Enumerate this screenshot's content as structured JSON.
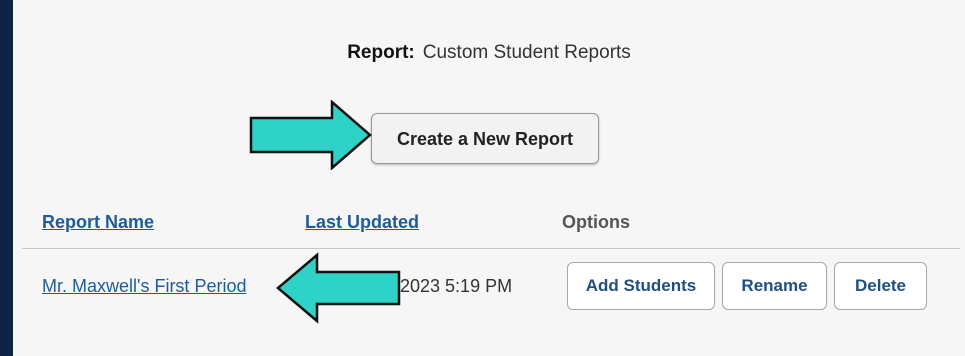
{
  "report": {
    "label": "Report:",
    "name": "Custom Student Reports"
  },
  "create_button": "Create a New Report",
  "table": {
    "headers": {
      "name": "Report Name",
      "updated": "Last Updated",
      "options": "Options"
    },
    "rows": [
      {
        "name": "Mr. Maxwell's First Period",
        "updated_visible": "2023 5:19 PM",
        "actions": [
          "Add Students",
          "Rename",
          "Delete"
        ]
      }
    ]
  },
  "colors": {
    "arrow_fill": "#2ed3c8",
    "link": "#1f5b9c",
    "frame": "#0f2444"
  }
}
